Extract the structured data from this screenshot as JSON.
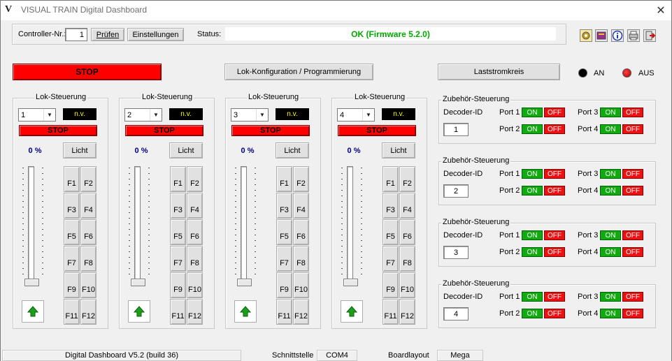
{
  "window": {
    "title": "VISUAL TRAIN Digital Dashboard",
    "close": "✕",
    "logo": "V"
  },
  "header": {
    "controller_label": "Controller-Nr.:",
    "controller_value": "1",
    "pruefen": "Prüfen",
    "einstellungen": "Einstellungen",
    "status_label": "Status:",
    "status_value": "OK (Firmware 5.2.0)",
    "status_color": "#00aa00"
  },
  "toolbar_icons": [
    "gear-icon",
    "book-icon",
    "info-icon",
    "printer-icon",
    "exit-icon"
  ],
  "main": {
    "stop_all": "STOP",
    "lok_konfig": "Lok-Konfiguration / Programmierung",
    "laststromkreis": "Laststromkreis",
    "an_label": "AN",
    "aus_label": "AUS"
  },
  "loks": [
    {
      "title": "Lok-Steuerung",
      "address": "1",
      "display": "n.v.",
      "stop": "STOP",
      "speed": "0 %",
      "licht": "Licht",
      "functions": [
        "F1",
        "F2",
        "F3",
        "F4",
        "F5",
        "F6",
        "F7",
        "F8",
        "F9",
        "F10",
        "F11",
        "F12"
      ],
      "speed_fraction": 0
    },
    {
      "title": "Lok-Steuerung",
      "address": "2",
      "display": "n.v.",
      "stop": "STOP",
      "speed": "0 %",
      "licht": "Licht",
      "functions": [
        "F1",
        "F2",
        "F3",
        "F4",
        "F5",
        "F6",
        "F7",
        "F8",
        "F9",
        "F10",
        "F11",
        "F12"
      ],
      "speed_fraction": 0
    },
    {
      "title": "Lok-Steuerung",
      "address": "3",
      "display": "n.v.",
      "stop": "STOP",
      "speed": "0 %",
      "licht": "Licht",
      "functions": [
        "F1",
        "F2",
        "F3",
        "F4",
        "F5",
        "F6",
        "F7",
        "F8",
        "F9",
        "F10",
        "F11",
        "F12"
      ],
      "speed_fraction": 0
    },
    {
      "title": "Lok-Steuerung",
      "address": "4",
      "display": "n.v.",
      "stop": "STOP",
      "speed": "0 %",
      "licht": "Licht",
      "functions": [
        "F1",
        "F2",
        "F3",
        "F4",
        "F5",
        "F6",
        "F7",
        "F8",
        "F9",
        "F10",
        "F11",
        "F12"
      ],
      "speed_fraction": 0
    }
  ],
  "accessories": [
    {
      "title": "Zubehör-Steuerung",
      "decoder_label": "Decoder-ID",
      "decoder_id": "1",
      "ports": [
        "Port 1",
        "Port 2",
        "Port 3",
        "Port 4"
      ],
      "on": "ON",
      "off": "OFF"
    },
    {
      "title": "Zubehör-Steuerung",
      "decoder_label": "Decoder-ID",
      "decoder_id": "2",
      "ports": [
        "Port 1",
        "Port 2",
        "Port 3",
        "Port 4"
      ],
      "on": "ON",
      "off": "OFF"
    },
    {
      "title": "Zubehör-Steuerung",
      "decoder_label": "Decoder-ID",
      "decoder_id": "3",
      "ports": [
        "Port 1",
        "Port 2",
        "Port 3",
        "Port 4"
      ],
      "on": "ON",
      "off": "OFF"
    },
    {
      "title": "Zubehör-Steuerung",
      "decoder_label": "Decoder-ID",
      "decoder_id": "4",
      "ports": [
        "Port 1",
        "Port 2",
        "Port 3",
        "Port 4"
      ],
      "on": "ON",
      "off": "OFF"
    }
  ],
  "statusbar": {
    "version": "Digital Dashboard V5.2 (build 36)",
    "schnittstelle_label": "Schnittstelle",
    "schnittstelle_value": "COM4",
    "boardlayout_label": "Boardlayout",
    "boardlayout_value": "Mega"
  }
}
